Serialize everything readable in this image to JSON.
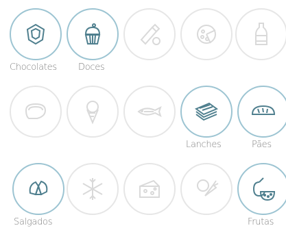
{
  "colors": {
    "active_ring": "#9cc4d2",
    "inactive_ring": "#e6e6e6",
    "label": "#7f7f7f"
  },
  "categories": [
    {
      "label": "Chocolates",
      "icon": "chocolate-icon",
      "active": true
    },
    {
      "label": "Doces",
      "icon": "cupcake-icon",
      "active": true
    },
    {
      "label": "",
      "icon": "baby-bottle-icon",
      "active": false
    },
    {
      "label": "",
      "icon": "pizza-icon",
      "active": false
    },
    {
      "label": "",
      "icon": "soda-bottle-icon",
      "active": false
    },
    {
      "label": "",
      "icon": "steak-icon",
      "active": false
    },
    {
      "label": "",
      "icon": "ice-cream-cone-icon",
      "active": false
    },
    {
      "label": "",
      "icon": "fish-icon",
      "active": false
    },
    {
      "label": "Lanches",
      "icon": "sandwich-icon",
      "active": true
    },
    {
      "label": "Pães",
      "icon": "bread-icon",
      "active": true
    },
    {
      "label": "Salgados",
      "icon": "croissant-icon",
      "active": true
    },
    {
      "label": "",
      "icon": "snowflake-icon",
      "active": false
    },
    {
      "label": "",
      "icon": "cheese-icon",
      "active": false
    },
    {
      "label": "",
      "icon": "vegetables-icon",
      "active": false
    },
    {
      "label": "Frutas",
      "icon": "fruits-icon",
      "active": true
    }
  ]
}
